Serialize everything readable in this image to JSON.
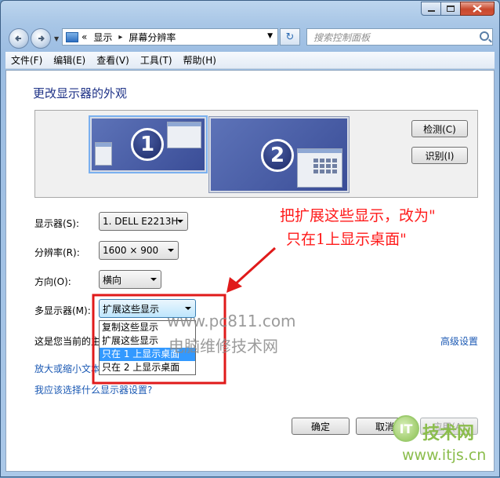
{
  "window": {
    "caption_buttons": [
      "minimize",
      "maximize",
      "close"
    ]
  },
  "address_bar": {
    "overflow": "«",
    "segments": [
      "显示",
      "屏幕分辨率"
    ],
    "separator": "▸",
    "search_placeholder": "搜索控制面板"
  },
  "menu": [
    "文件(F)",
    "编辑(E)",
    "查看(V)",
    "工具(T)",
    "帮助(H)"
  ],
  "page": {
    "title": "更改显示器的外观",
    "detect_button": "检测(C)",
    "identify_button": "识别(I)",
    "monitors": [
      {
        "number": "1",
        "selected": true
      },
      {
        "number": "2",
        "selected": false
      }
    ]
  },
  "settings": {
    "display_label": "显示器(S):",
    "display_value": "1. DELL E2213H",
    "resolution_label": "分辨率(R):",
    "resolution_value": "1600 × 900",
    "orientation_label": "方向(O):",
    "orientation_value": "横向",
    "multi_label": "多显示器(M):",
    "multi_value": "扩展这些显示",
    "multi_options": [
      "复制这些显示",
      "扩展这些显示",
      "只在 1 上显示桌面",
      "只在 2 上显示桌面"
    ],
    "highlighted_option": "只在 1 上显示桌面",
    "current_text": "这是您当前的主",
    "advanced_link": "高级设置",
    "enlarge_link": "放大或缩小文本",
    "help_link": "我应该选择什么显示器设置?"
  },
  "buttons": {
    "ok": "确定",
    "cancel": "取消",
    "apply": "应用(A)"
  },
  "annotation": {
    "line1": "把扩展这些显示，改为\"",
    "line2": "只在1上显示桌面\"",
    "color": "#ff1a1a"
  },
  "watermarks": {
    "site": "www.pc811.com",
    "site_name": "电脑维修技术网",
    "brand_mark": "IT",
    "brand": "技术网",
    "brand_url": "www.itjs.cn"
  }
}
